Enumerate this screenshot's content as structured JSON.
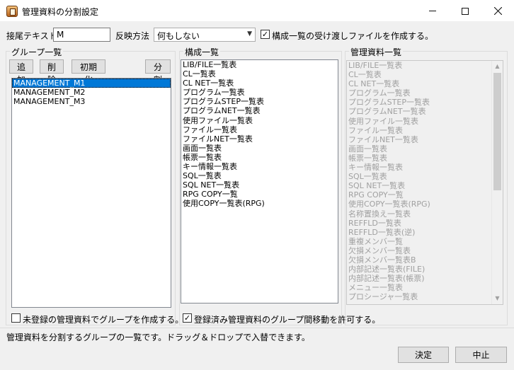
{
  "window": {
    "title": "管理資料の分割設定",
    "minimize_icon": "minimize-icon",
    "maximize_icon": "maximize-icon",
    "close_icon": "close-icon"
  },
  "options": {
    "suffix_label": "接尾テキスト",
    "suffix_value": "M",
    "reflect_label": "反映方法",
    "reflect_selected": "何もしない",
    "create_file_label": "構成一覧の受け渡しファイルを作成する。",
    "create_file_checked": "✓"
  },
  "groups": {
    "title": "グループ一覧",
    "add_label": "追加",
    "delete_label": "削除",
    "reset_label": "初期化",
    "split_label": "分割",
    "items": [
      "MANAGEMENT_M1",
      "MANAGEMENT_M2",
      "MANAGEMENT_M3"
    ],
    "selected_index": 0,
    "unregistered_label": "未登録の管理資料でグループを作成する。",
    "unregistered_checked": ""
  },
  "composition": {
    "title": "構成一覧",
    "items": [
      "LIB/FILE一覧表",
      "CL一覧表",
      "CL NET一覧表",
      "プログラム一覧表",
      "プログラムSTEP一覧表",
      "プログラムNET一覧表",
      "使用ファイル一覧表",
      "ファイル一覧表",
      "ファイルNET一覧表",
      "画面一覧表",
      "帳票一覧表",
      "キー情報一覧表",
      "SQL一覧表",
      "SQL NET一覧表",
      "RPG COPY一覧",
      "使用COPY一覧表(RPG)"
    ],
    "allow_move_label": "登録済み管理資料のグループ間移動を許可する。",
    "allow_move_checked": "✓"
  },
  "management": {
    "title": "管理資料一覧",
    "items": [
      "LIB/FILE一覧表",
      "CL一覧表",
      "CL NET一覧表",
      "プログラム一覧表",
      "プログラムSTEP一覧表",
      "プログラムNET一覧表",
      "使用ファイル一覧表",
      "ファイル一覧表",
      "ファイルNET一覧表",
      "画面一覧表",
      "帳票一覧表",
      "キー情報一覧表",
      "SQL一覧表",
      "SQL NET一覧表",
      "RPG COPY一覧",
      "使用COPY一覧表(RPG)",
      "名称置換え一覧表",
      "REFFLD一覧表",
      "REFFLD一覧表(逆)",
      "重複メンバ一覧",
      "欠損メンバ一覧表",
      "欠損メンバ一覧表B",
      "内部記述一覧表(FILE)",
      "内部記述一覧表(帳票)",
      "メニュー一覧表",
      "プロシージャ一覧表"
    ]
  },
  "status_text": "管理資料を分割するグループの一覧です。ドラッグ＆ドロップで入替できます。",
  "footer": {
    "ok_label": "決定",
    "cancel_label": "中止"
  },
  "colors": {
    "selection": "#0078d7",
    "window_bg": "#f0f0f0",
    "disabled_text": "#a0a0a0"
  }
}
